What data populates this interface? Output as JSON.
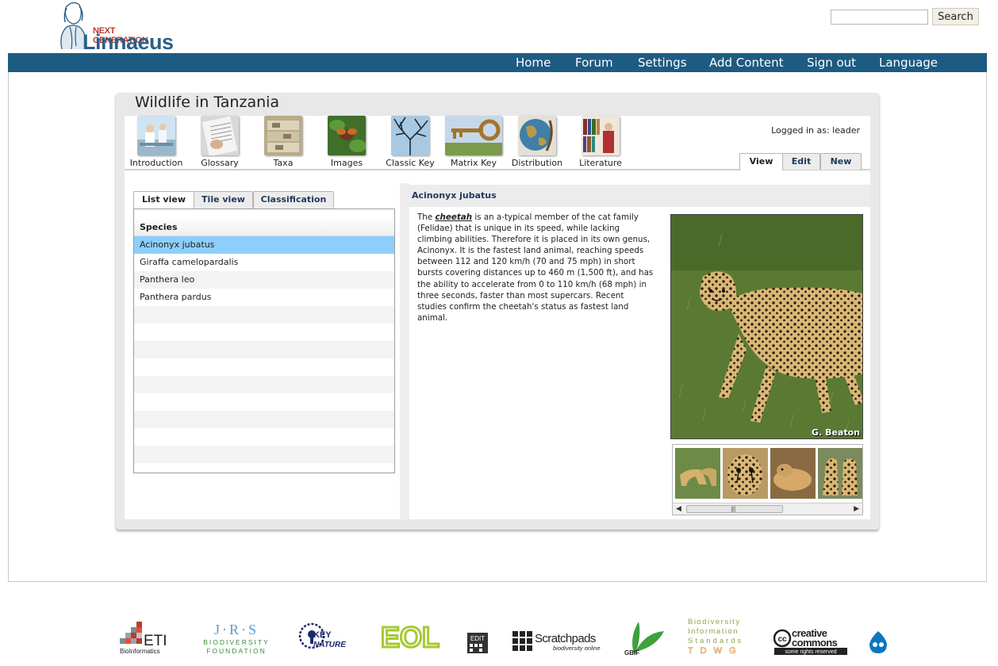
{
  "header": {
    "logo": {
      "top_text": "NEXT GENERATION",
      "name": "Linnaeus"
    },
    "search": {
      "value": "",
      "placeholder": "",
      "button": "Search"
    },
    "nav": [
      "Home",
      "Forum",
      "Settings",
      "Add Content",
      "Sign out",
      "Language"
    ]
  },
  "panel": {
    "title": "Wildlife in Tanzania",
    "logged_in": "Logged in as: leader",
    "tools": [
      {
        "label": "Introduction",
        "icon": "introduction-icon"
      },
      {
        "label": "Glossary",
        "icon": "glossary-icon"
      },
      {
        "label": "Taxa",
        "icon": "taxa-icon"
      },
      {
        "label": "Images",
        "icon": "images-icon"
      },
      {
        "label": "Classic Key",
        "icon": "classic-key-icon"
      },
      {
        "label": "Matrix Key",
        "icon": "matrix-key-icon"
      },
      {
        "label": "Distribution",
        "icon": "distribution-icon"
      },
      {
        "label": "Literature",
        "icon": "literature-icon"
      }
    ],
    "view_tabs": [
      "View",
      "Edit",
      "New"
    ],
    "list_tabs": [
      "List view",
      "Tile view",
      "Classification"
    ],
    "list_header": "Species",
    "species": [
      "Acinonyx jubatus",
      "Giraffa camelopardalis",
      "Panthera leo",
      "Panthera pardus"
    ],
    "selected_species": "Acinonyx jubatus",
    "detail": {
      "title": "Acinonyx jubatus",
      "text_before": "The ",
      "link": "cheetah",
      "text_after": " is an a-typical member of the cat family (Felidae) that is unique in its speed, while lacking climbing abilities. Therefore it is placed in its own genus, Acinonyx. It is the fastest land animal, reaching speeds between 112 and 120 km/h (70 and 75 mph) in short bursts covering distances up to 460 m (1,500 ft), and has the ability to accelerate from 0 to 110 km/h (68 mph) in three seconds, faster than most supercars. Recent studies confirm the cheetah's status as fastest land animal.",
      "image_credit": "G. Beaton"
    }
  },
  "footer": {
    "logos": [
      "ETI BioInformatics",
      "JRS Biodiversity Foundation",
      "KeyToNature",
      "EOL",
      "EDIT",
      "Scratchpads",
      "GBIF",
      "Biodiversity Information Standards TDWG",
      "creative commons",
      "Drupal"
    ],
    "eti": {
      "big": "ETI",
      "small": "BioInformatics"
    },
    "jrs": {
      "big": "J·R·S",
      "small": "BIODIVERSITY",
      "small2": "FOUNDATION"
    },
    "key": {
      "big": "KEY",
      "small": "NATURE"
    },
    "eol": "EOL",
    "edit": "EDIT",
    "scratch": {
      "big": "Scratchpads",
      "small": "biodiversity online"
    },
    "gbif": "GBIF",
    "tdwg": [
      "Biodiversity",
      "Information",
      "Standards",
      "T D W G"
    ],
    "cc": {
      "big": "creative",
      "big2": "commons",
      "small": "some rights reserved"
    }
  }
}
